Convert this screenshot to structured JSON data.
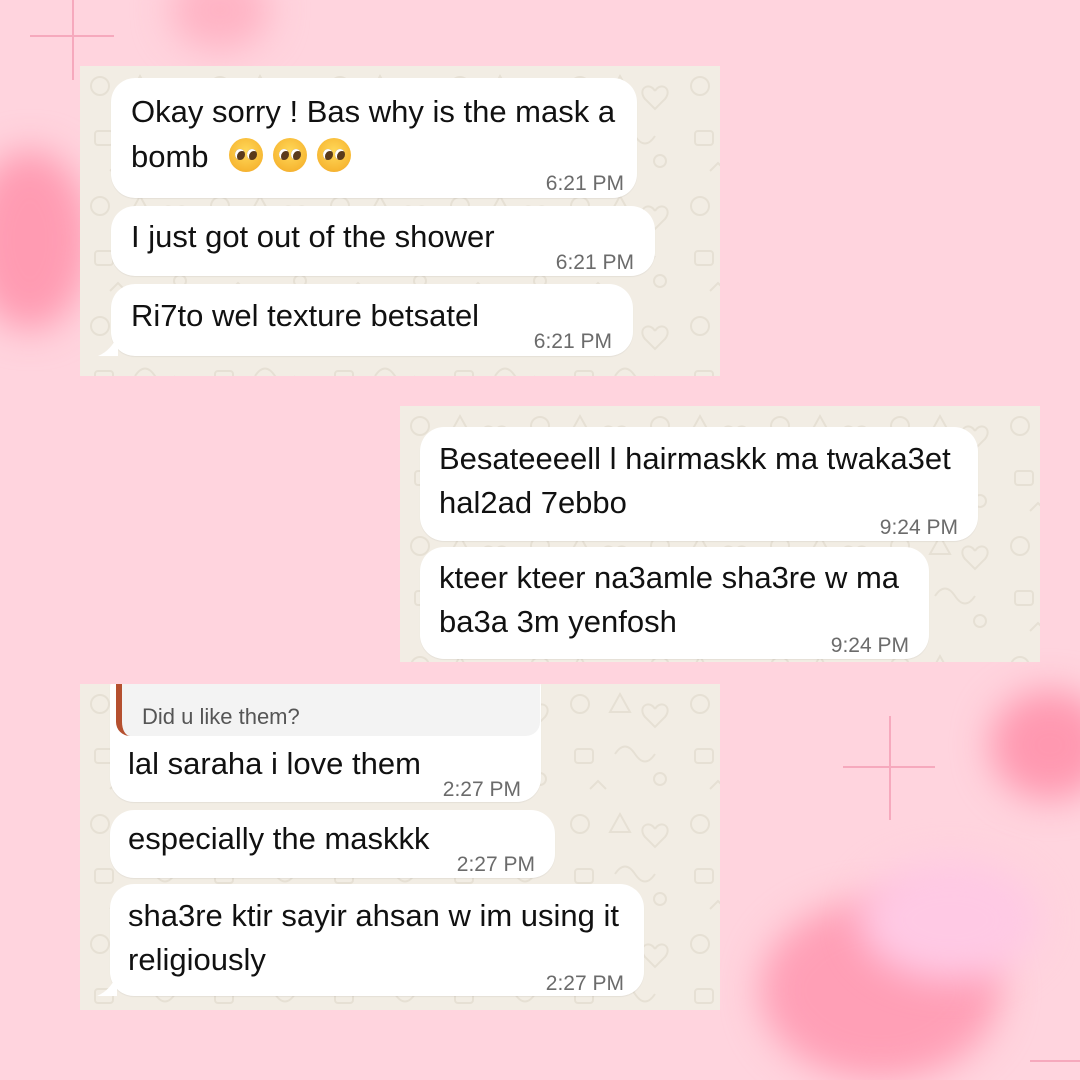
{
  "colors": {
    "background": "#ffd4de",
    "panel": "#f2ede4",
    "bubble": "#ffffff",
    "reply_accent": "#b5502f"
  },
  "emoji_icon": "pleading-face-emoji",
  "chat1": {
    "messages": [
      {
        "line1": "Okay sorry ! Bas why is the mask a",
        "line2": "bomb",
        "time": "6:21 PM"
      },
      {
        "text": "I just got out of the shower",
        "time": "6:21 PM"
      },
      {
        "text": "Ri7to wel texture betsatel",
        "time": "6:21 PM"
      }
    ]
  },
  "chat2": {
    "messages": [
      {
        "line1": "Besateeeell l hairmaskk ma twaka3et",
        "line2": "hal2ad 7ebbo",
        "time": "9:24 PM"
      },
      {
        "line1": "kteer kteer na3amle sha3re w ma",
        "line2": "ba3a 3m yenfosh",
        "time": "9:24 PM"
      }
    ]
  },
  "chat3": {
    "reply_quote": "Did u like them?",
    "messages": [
      {
        "text": "lal saraha i love them",
        "time": "2:27 PM"
      },
      {
        "text": "especially the maskkk",
        "time": "2:27 PM"
      },
      {
        "line1": "sha3re ktir sayir ahsan w im using it",
        "line2": "religiously",
        "time": "2:27 PM"
      }
    ]
  }
}
